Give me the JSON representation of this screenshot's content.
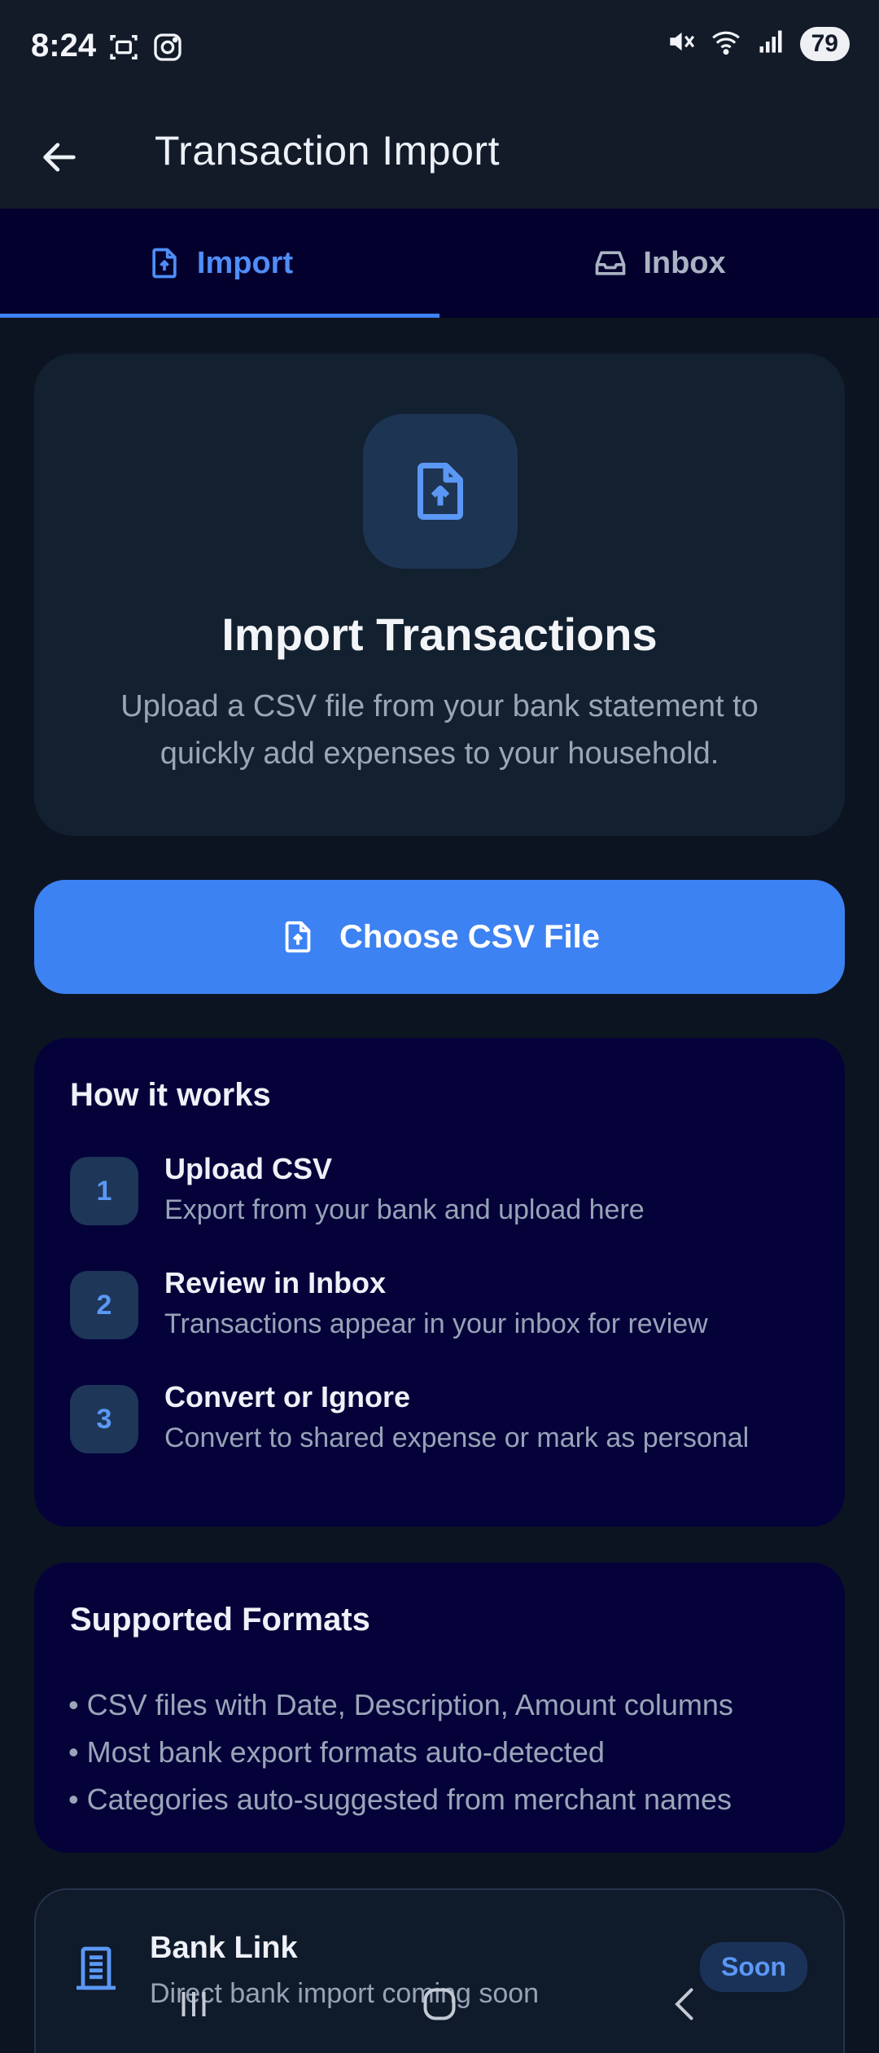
{
  "status_bar": {
    "time": "8:24",
    "battery": "79",
    "left_icons": [
      "screenshot-icon",
      "instagram-icon"
    ],
    "right_icons": [
      "mute-icon",
      "wifi-icon",
      "signal-icon"
    ]
  },
  "app_bar": {
    "title": "Transaction Import",
    "back_icon": "arrow-left-icon"
  },
  "tabs": [
    {
      "label": "Import",
      "icon": "file-upload-icon",
      "active": true
    },
    {
      "label": "Inbox",
      "icon": "inbox-icon",
      "active": false
    }
  ],
  "hero": {
    "title": "Import Transactions",
    "description": "Upload a CSV file from your bank statement to quickly add expenses to your household."
  },
  "choose_button": {
    "label": "Choose CSV File",
    "icon": "file-upload-icon"
  },
  "how_it_works": {
    "heading": "How it works",
    "steps": [
      {
        "number": "1",
        "title": "Upload CSV",
        "description": "Export from your bank and upload here"
      },
      {
        "number": "2",
        "title": "Review in Inbox",
        "description": "Transactions appear in your inbox for review"
      },
      {
        "number": "3",
        "title": "Convert or Ignore",
        "description": "Convert to shared expense or mark as personal"
      }
    ]
  },
  "supported_formats": {
    "heading": "Supported Formats",
    "items": [
      "• CSV files with Date, Description, Amount columns",
      "• Most bank export formats auto-detected",
      "• Categories auto-suggested from merchant names"
    ]
  },
  "bank_link": {
    "title": "Bank Link",
    "description": "Direct bank import coming soon",
    "badge": "Soon",
    "icon": "bank-building-icon"
  },
  "colors": {
    "accent": "#3d82f2",
    "background": "#0d1421",
    "card": "#05023a"
  }
}
